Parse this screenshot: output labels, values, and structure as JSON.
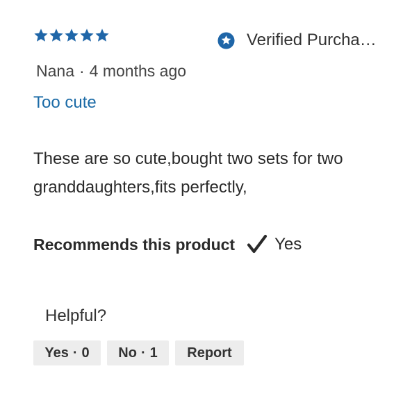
{
  "review": {
    "rating": 5,
    "rating_max": 5,
    "verified_label": "Verified Purcha…",
    "author": "Nana",
    "separator": "·",
    "time_ago": "4 months ago",
    "title": "Too cute",
    "body": "These are so cute,bought two sets for two granddaughters,fits perfectly,",
    "recommend_label": "Recommends this product",
    "recommend_value": "Yes"
  },
  "helpful": {
    "prompt": "Helpful?",
    "yes_label": "Yes",
    "yes_count": "0",
    "no_label": "No",
    "no_count": "1",
    "dot": "·",
    "report_label": "Report"
  },
  "colors": {
    "star": "#1f66a8",
    "title_link": "#1a6aa6",
    "button_bg": "#ededed"
  },
  "icons": {
    "star": "star-icon",
    "verified": "verified-star-badge-icon",
    "recommend": "checkmark-icon"
  }
}
